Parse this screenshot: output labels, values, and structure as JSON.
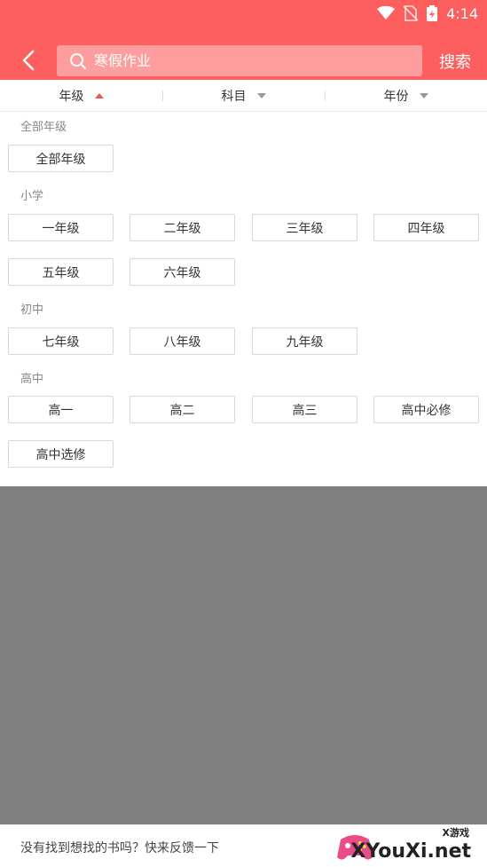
{
  "status_bar": {
    "time": "4:14"
  },
  "search": {
    "placeholder": "寒假作业",
    "button_label": "搜索"
  },
  "filters": [
    {
      "label": "年级",
      "state": "expanded"
    },
    {
      "label": "科目",
      "state": "collapsed"
    },
    {
      "label": "年份",
      "state": "collapsed"
    }
  ],
  "grade_panel": {
    "sections": [
      {
        "title": "全部年级",
        "options": [
          "全部年级"
        ]
      },
      {
        "title": "小学",
        "options": [
          "一年级",
          "二年级",
          "三年级",
          "四年级",
          "五年级",
          "六年级"
        ]
      },
      {
        "title": "初中",
        "options": [
          "七年级",
          "八年级",
          "九年级"
        ]
      },
      {
        "title": "高中",
        "options": [
          "高一",
          "高二",
          "高三",
          "高中必修",
          "高中选修"
        ]
      }
    ]
  },
  "footer": {
    "feedback_text": "没有找到想找的书吗？快来反馈一下"
  },
  "watermark": {
    "brand": "XYouXi.net",
    "tag": "X游戏"
  },
  "colors": {
    "header": "#fd5e5e",
    "accent": "#e9585a",
    "overlay": "#808080"
  }
}
